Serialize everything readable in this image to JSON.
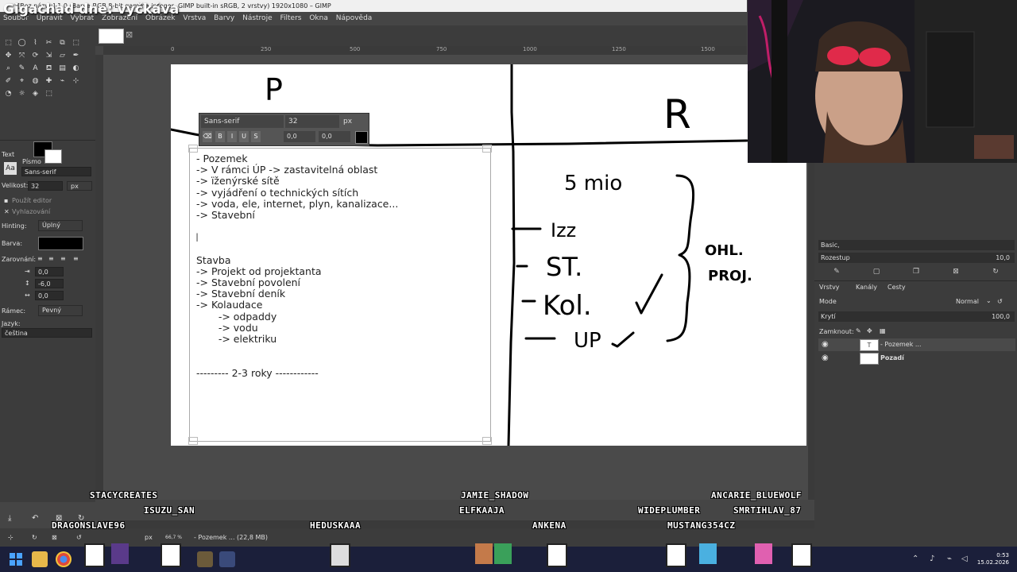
{
  "window": {
    "title": "*[Bez názvu]-1.0 (Barva RGB 8-bit gamma integer, GIMP built-in sRGB, 2 vrstvy) 1920x1080 – GIMP",
    "stream_title": "Gigachad dne:  vyčkáva"
  },
  "menubar": [
    "Soubor",
    "Upravit",
    "Vybrat",
    "Zobrazení",
    "Obrázek",
    "Vrstva",
    "Barvy",
    "Nástroje",
    "Filters",
    "Okna",
    "Nápověda"
  ],
  "ruler_marks": [
    "0",
    "250",
    "500",
    "750",
    "1000",
    "1250",
    "1500"
  ],
  "tool_options": {
    "tab": "Text",
    "font_label": "Písmo",
    "font_value": "Sans-serif",
    "size_label": "Velikost:",
    "size_value": "32",
    "size_unit": "px",
    "use_editor": "Použít editor",
    "antialias": "Vyhlazování",
    "hinting_label": "Hinting:",
    "hinting_value": "Úplný",
    "color_label": "Barva:",
    "justify_label": "Zarovnání:",
    "indent": "0,0",
    "line_spacing": "-6,0",
    "letter_spacing": "0,0",
    "box_label": "Rámec:",
    "box_value": "Pevný",
    "language_label": "Jazyk:",
    "language_value": "čeština"
  },
  "canvas_toolbar": {
    "font": "Sans-serif",
    "size": "32",
    "unit": "px",
    "baseline": "0,0",
    "kerning": "0,0"
  },
  "text_layer_lines": [
    "- Pozemek",
    "-> V rámci ÚP -> zastavitelná oblast",
    "-> ïženýrské sítě",
    "-> vyjádření o technických sítích",
    "-> voda, ele, internet, plyn, kanalizace...",
    "-> Stavební",
    "",
    "",
    "",
    "Stavba",
    "-> Projekt od projektanta",
    "-> Stavební povolení",
    "-> Stavební deník",
    "-> Kolaudace",
    "       -> odpaddy",
    "       -> vodu",
    "       -> elektriku",
    "",
    "",
    "--------- 2-3 roky ------------"
  ],
  "handwriting": {
    "left_header": "P",
    "right_header": "R",
    "total": "5 mio",
    "items": [
      "Izz",
      "ST.",
      "Kol.",
      "UP"
    ],
    "bracket_note_1": "OHL.",
    "bracket_note_2": "PROJ."
  },
  "right_dock": {
    "brush_preset": "Basic,",
    "spacing_label": "Rozestup",
    "spacing_value": "10,0",
    "tabs": [
      "Vrstvy",
      "Kanály",
      "Cesty"
    ],
    "mode_label": "Mode",
    "mode_value": "Normal",
    "opacity_label": "Krytí",
    "opacity_value": "100,0",
    "lock_label": "Zamknout:",
    "layers": [
      {
        "name": "- Pozemek ...",
        "thumb": "T"
      },
      {
        "name": "Pozadí",
        "thumb": ""
      }
    ]
  },
  "statusbar": {
    "unit": "px",
    "zoom": "66,7 %",
    "layer_info": "- Pozemek ... (22,8 MB)"
  },
  "chat_names": [
    "STACYCREATES",
    "ISUZU_SAN",
    "DRAGONSLAVE96",
    "HEDUSKAAA",
    "JAMIE_SHADOW",
    "ELFKAAJA",
    "ANKENA",
    "WIDEPLUMBER",
    "MUSTANG354CZ",
    "ANCARIE_BLUEWOLF",
    "SMRTIHLAV_87"
  ],
  "taskbar": {
    "time": "0:53",
    "date": "15.02.2026"
  },
  "colors": {
    "gimp_panel": "#3c3c3c",
    "canvas_bg": "#4a4a4a",
    "taskbar": "#1b1f3a"
  }
}
